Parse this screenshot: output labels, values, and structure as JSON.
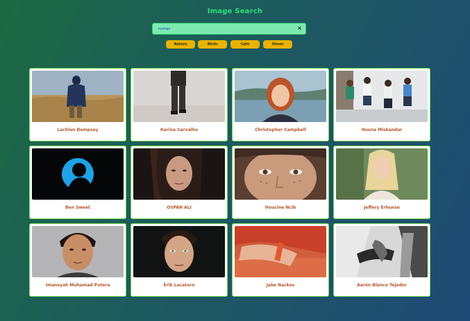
{
  "app": {
    "title": "Image Search"
  },
  "search": {
    "value": "human",
    "clear_label": "×"
  },
  "filters": [
    "Nature",
    "Birds",
    "Cats",
    "Shoes"
  ],
  "colors": {
    "title": "#2ee07a",
    "search_bg": "#7ce9b0",
    "filter_bg": "#e8b300",
    "card_border": "#6fdc4a",
    "name_text": "#b5542a"
  },
  "results": [
    {
      "name": "Lachlan Dempsey",
      "image": "person-in-field-photo"
    },
    {
      "name": "Karina Carvalho",
      "image": "legs-floating-photo"
    },
    {
      "name": "Christopher Campbell",
      "image": "red-hair-woman-lake-photo"
    },
    {
      "name": "Husna Miskandar",
      "image": "group-jumping-photo"
    },
    {
      "name": "Ben Sweet",
      "image": "blue-silhouette-icon-photo"
    },
    {
      "name": "OSPAN ALI",
      "image": "woman-portrait-photo"
    },
    {
      "name": "Houcine Ncib",
      "image": "freckled-eyes-photo"
    },
    {
      "name": "Jeffery Erhunse",
      "image": "blonde-woman-photo"
    },
    {
      "name": "Imansyah Muhamad Putera",
      "image": "young-man-portrait-photo"
    },
    {
      "name": "Erik Lucatero",
      "image": "boy-green-eyes-photo"
    },
    {
      "name": "Jake Nackos",
      "image": "hand-with-tag-photo"
    },
    {
      "name": "Aarón Blanco Tejedor",
      "image": "holding-hands-bw-photo"
    }
  ]
}
